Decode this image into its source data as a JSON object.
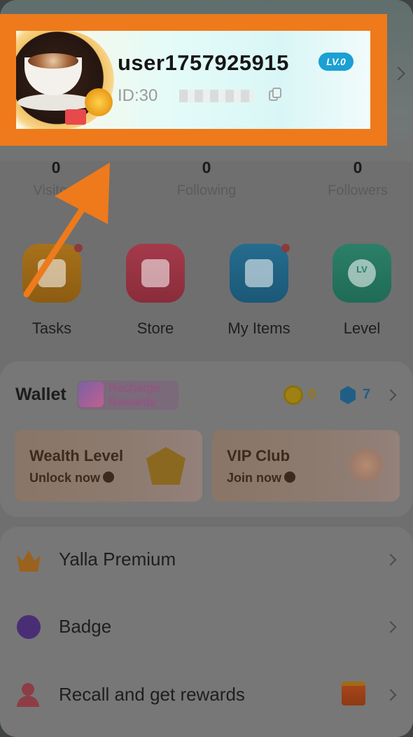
{
  "profile": {
    "username": "user1757925915",
    "level_badge": "LV.0",
    "user_id": "ID:30"
  },
  "stats": [
    {
      "value": "0",
      "label": "Visitors"
    },
    {
      "value": "0",
      "label": "Following"
    },
    {
      "value": "0",
      "label": "Followers"
    }
  ],
  "features": [
    {
      "label": "Tasks",
      "icon": "calendar-icon"
    },
    {
      "label": "Store",
      "icon": "store-icon"
    },
    {
      "label": "My Items",
      "icon": "tshirt-icon"
    },
    {
      "label": "Level",
      "icon": "level-icon",
      "glyph": "LV"
    }
  ],
  "wallet": {
    "title": "Wallet",
    "recharge_line1": "Recharge",
    "recharge_line2": "Rewards",
    "coins": "0",
    "gems": "7"
  },
  "promos": [
    {
      "title": "Wealth Level",
      "subtitle": "Unlock now"
    },
    {
      "title": "VIP Club",
      "subtitle": "Join now"
    }
  ],
  "menu": [
    {
      "label": "Yalla Premium",
      "icon": "crown-icon"
    },
    {
      "label": "Badge",
      "icon": "badge-icon"
    },
    {
      "label": "Recall and get rewards",
      "icon": "person-heart-icon"
    }
  ],
  "colors": {
    "highlight": "#ee7a1b",
    "level_badge": "#1aa0d4"
  }
}
